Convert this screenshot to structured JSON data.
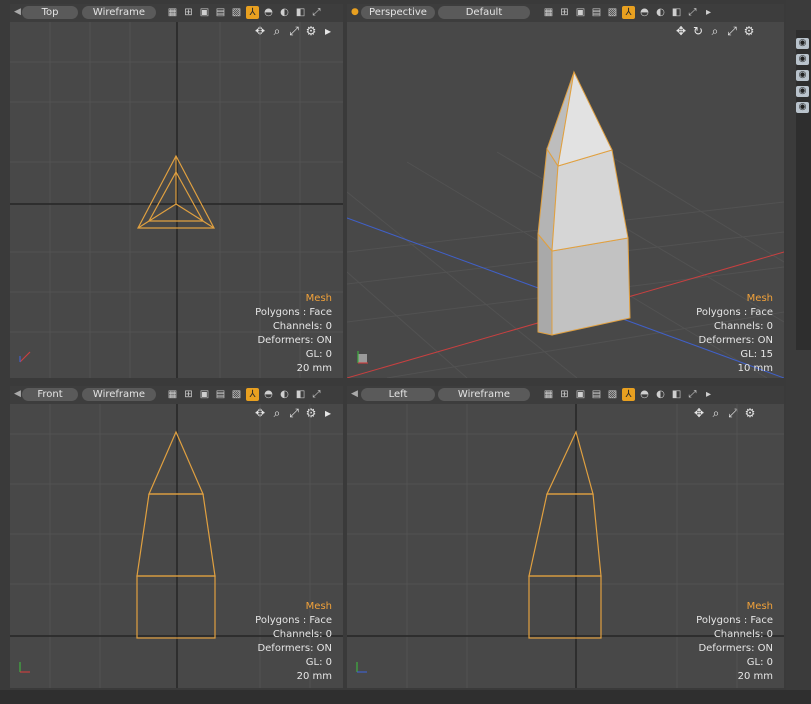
{
  "viewports": {
    "top": {
      "view_label": "Top",
      "shading_label": "Wireframe",
      "info": {
        "mesh": "Mesh",
        "polygons": "Polygons : Face",
        "channels": "Channels: 0",
        "deformers": "Deformers: ON",
        "gl": "GL: 0",
        "unit": "20 mm"
      }
    },
    "perspective": {
      "view_label": "Perspective",
      "shading_label": "Default",
      "info": {
        "mesh": "Mesh",
        "polygons": "Polygons : Face",
        "channels": "Channels: 0",
        "deformers": "Deformers: ON",
        "gl": "GL: 15",
        "unit": "10 mm"
      }
    },
    "front": {
      "view_label": "Front",
      "shading_label": "Wireframe",
      "info": {
        "mesh": "Mesh",
        "polygons": "Polygons : Face",
        "channels": "Channels: 0",
        "deformers": "Deformers: ON",
        "gl": "GL: 0",
        "unit": "20 mm"
      }
    },
    "left": {
      "view_label": "Left",
      "shading_label": "Wireframe",
      "info": {
        "mesh": "Mesh",
        "polygons": "Polygons : Face",
        "channels": "Channels: 0",
        "deformers": "Deformers: ON",
        "gl": "GL: 0",
        "unit": "20 mm"
      }
    }
  },
  "colors": {
    "accent": "#e8a020",
    "wireframe": "#e0a040",
    "grid_line": "#525252",
    "axis_red": "#c84040",
    "axis_blue": "#4060c8",
    "axis_green": "#40b040"
  }
}
